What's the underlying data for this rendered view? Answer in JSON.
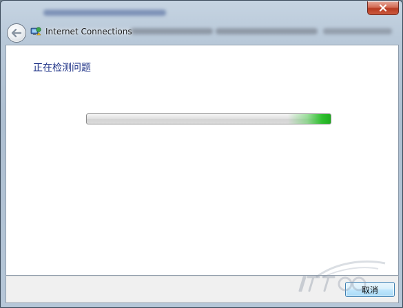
{
  "window": {
    "title": "Internet Connections",
    "close_button": "close-icon",
    "back_button": "back-arrow-icon",
    "wizard_icon": "network-troubleshooter-icon"
  },
  "content": {
    "heading": "正在检测问题",
    "progress": {
      "value": 1.0,
      "indeterminate": true,
      "fill_color": "#2fbf2f"
    }
  },
  "footer": {
    "cancel_label": "取消"
  },
  "colors": {
    "heading": "#1e3287",
    "close_button": "#c74a31",
    "button_border": "#3c7fb1"
  }
}
